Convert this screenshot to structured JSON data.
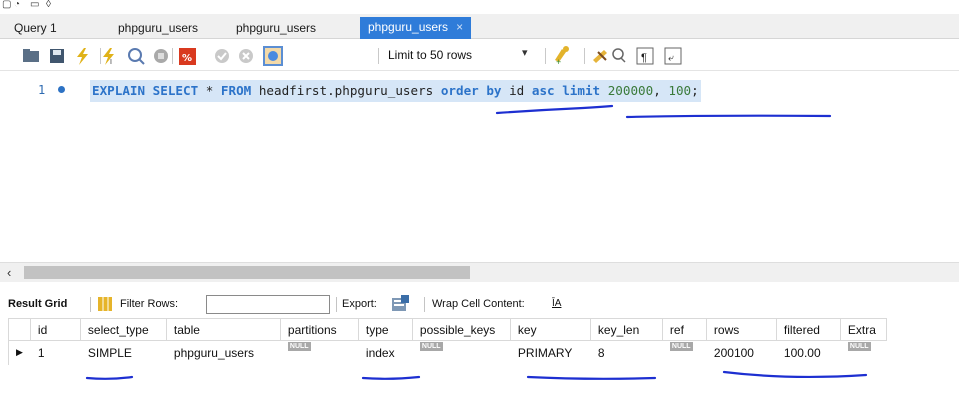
{
  "tabs": [
    {
      "label": "Query 1",
      "active": false
    },
    {
      "label": "phpguru_users",
      "active": false
    },
    {
      "label": "phpguru_users",
      "active": false
    },
    {
      "label": "phpguru_users",
      "active": true,
      "close": "×"
    }
  ],
  "toolbar": {
    "limit_label": "Limit to 50 rows",
    "icons": [
      "folder-icon",
      "save-icon",
      "execute-icon",
      "execute-current-icon",
      "explain-icon",
      "stop-icon",
      "toggle-output-icon",
      "commit-icon",
      "rollback-icon",
      "autocommit-icon",
      "beautify-icon",
      "find-icon",
      "invisibles-icon",
      "wrap-icon"
    ]
  },
  "editor": {
    "line_number": "1",
    "sql_tokens": [
      {
        "t": "EXPLAIN",
        "c": "kw"
      },
      {
        "t": " ",
        "c": "op"
      },
      {
        "t": "SELECT",
        "c": "kw"
      },
      {
        "t": " * ",
        "c": "op"
      },
      {
        "t": "FROM",
        "c": "kw"
      },
      {
        "t": " headfirst.phpguru_users ",
        "c": "id"
      },
      {
        "t": "order",
        "c": "kw"
      },
      {
        "t": " ",
        "c": "op"
      },
      {
        "t": "by",
        "c": "kw"
      },
      {
        "t": " id ",
        "c": "id"
      },
      {
        "t": "asc",
        "c": "kw"
      },
      {
        "t": " ",
        "c": "op"
      },
      {
        "t": "limit",
        "c": "kw"
      },
      {
        "t": " ",
        "c": "op"
      },
      {
        "t": "200000",
        "c": "num"
      },
      {
        "t": ", ",
        "c": "op"
      },
      {
        "t": "100",
        "c": "num"
      },
      {
        "t": ";",
        "c": "op"
      }
    ]
  },
  "result_toolbar": {
    "result_grid": "Result Grid",
    "filter_rows": "Filter Rows:",
    "filter_value": "",
    "export": "Export:",
    "wrap": "Wrap Cell Content:",
    "wrap_icon": "ĪA"
  },
  "grid": {
    "columns": [
      "id",
      "select_type",
      "table",
      "partitions",
      "type",
      "possible_keys",
      "key",
      "key_len",
      "ref",
      "rows",
      "filtered",
      "Extra"
    ],
    "rows": [
      [
        "1",
        "SIMPLE",
        "phpguru_users",
        "NULL",
        "index",
        "NULL",
        "PRIMARY",
        "8",
        "NULL",
        "200100",
        "100.00",
        "NULL"
      ]
    ],
    "row_marker": "▶"
  },
  "colors": {
    "active_tab": "#2f7cd9",
    "keyword": "#2c73c9",
    "ink": "#1d2fd1"
  }
}
